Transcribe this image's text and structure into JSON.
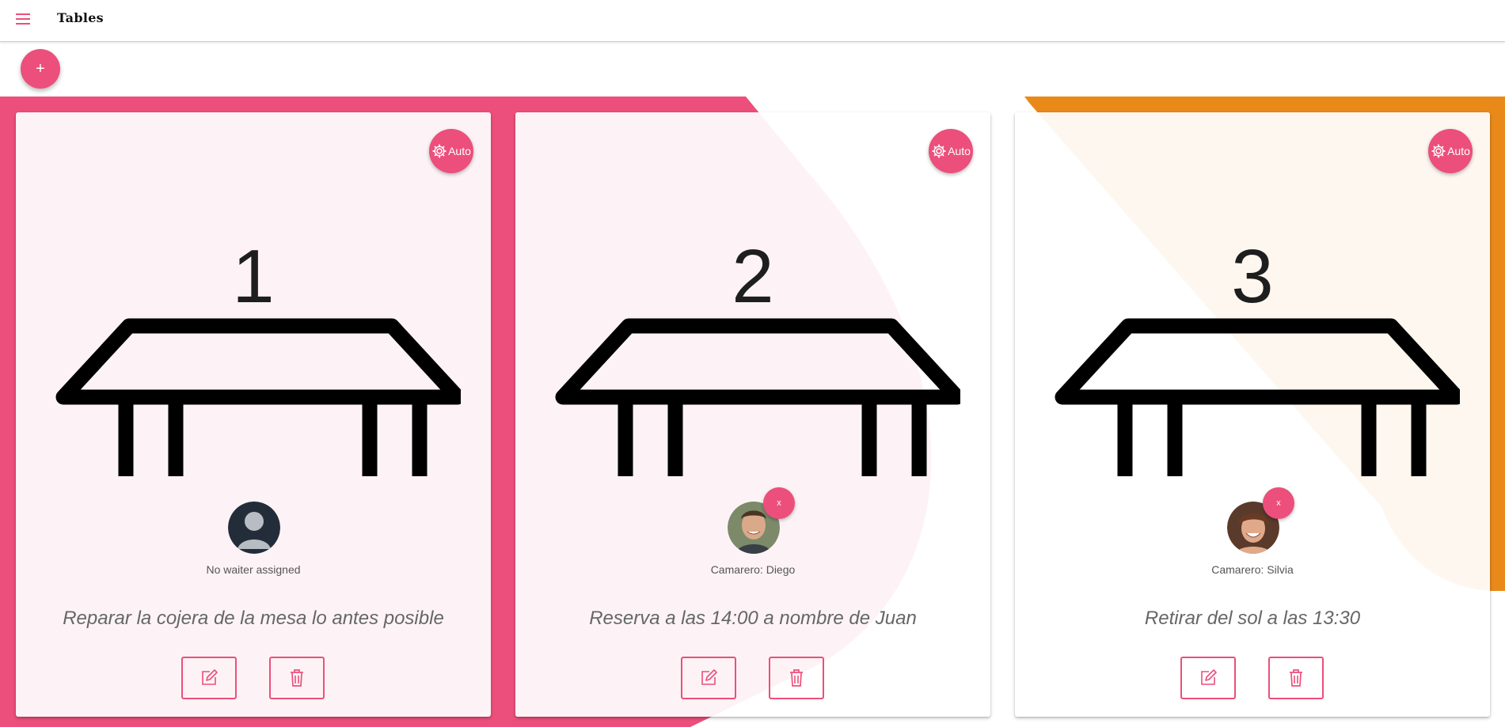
{
  "app": {
    "title": "Tables"
  },
  "toolbar": {
    "add_label": "+"
  },
  "colors": {
    "accent": "#ec4f7b",
    "accent_light": "#fdf3f6",
    "orange": "#e8891a",
    "cream": "#fdf7ef"
  },
  "tables": [
    {
      "number": "1",
      "auto_label": "Auto",
      "waiter": "No waiter assigned",
      "has_waiter": false,
      "remove_label": "",
      "note": "Reparar la cojera de la mesa lo antes posible",
      "edit_icon": "edit-icon",
      "delete_icon": "trash-icon"
    },
    {
      "number": "2",
      "auto_label": "Auto",
      "waiter": "Camarero: Diego",
      "has_waiter": true,
      "remove_label": "x",
      "note": "Reserva a las 14:00 a nombre de Juan",
      "edit_icon": "edit-icon",
      "delete_icon": "trash-icon"
    },
    {
      "number": "3",
      "auto_label": "Auto",
      "waiter": "Camarero: Silvia",
      "has_waiter": true,
      "remove_label": "x",
      "note": "Retirar del sol a las 13:30",
      "edit_icon": "edit-icon",
      "delete_icon": "trash-icon"
    }
  ]
}
